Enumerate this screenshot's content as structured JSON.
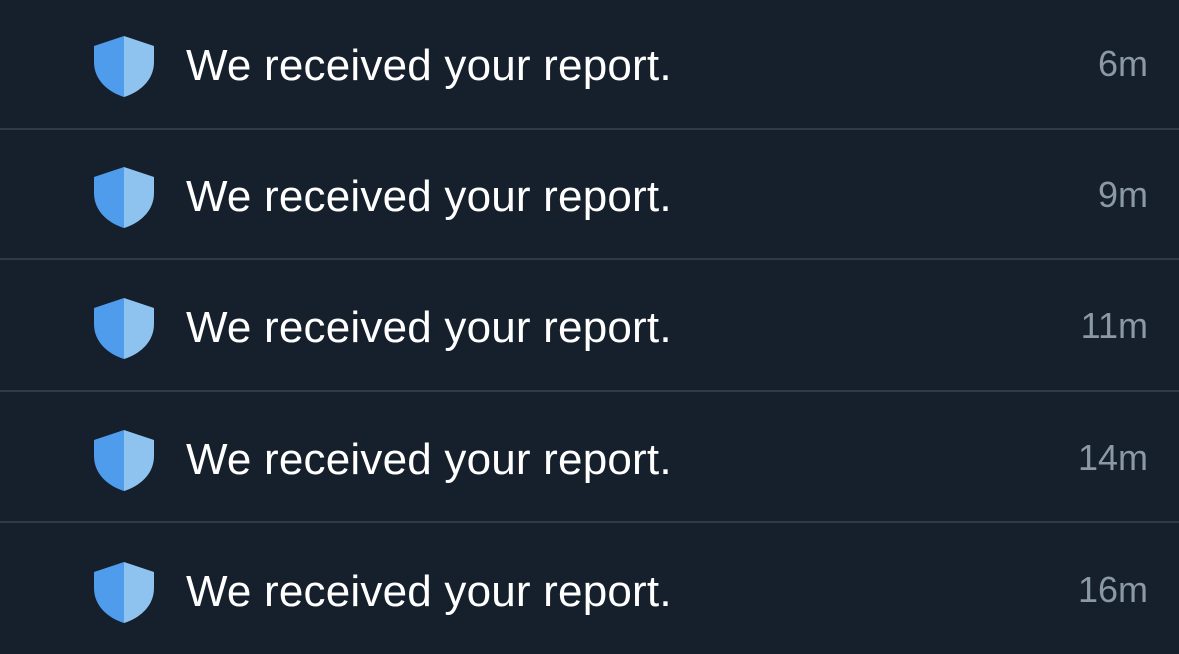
{
  "notifications": [
    {
      "icon": "shield-icon",
      "message": "We received your report.",
      "time": "6m"
    },
    {
      "icon": "shield-icon",
      "message": "We received your report.",
      "time": "9m"
    },
    {
      "icon": "shield-icon",
      "message": "We received your report.",
      "time": "11m"
    },
    {
      "icon": "shield-icon",
      "message": "We received your report.",
      "time": "14m"
    },
    {
      "icon": "shield-icon",
      "message": "We received your report.",
      "time": "16m"
    }
  ],
  "colors": {
    "background": "#16202c",
    "divider": "#2e3a48",
    "message_text": "#ffffff",
    "time_text": "#8b98a5",
    "shield_dark": "#4f9ced",
    "shield_light": "#8ec3f0"
  }
}
